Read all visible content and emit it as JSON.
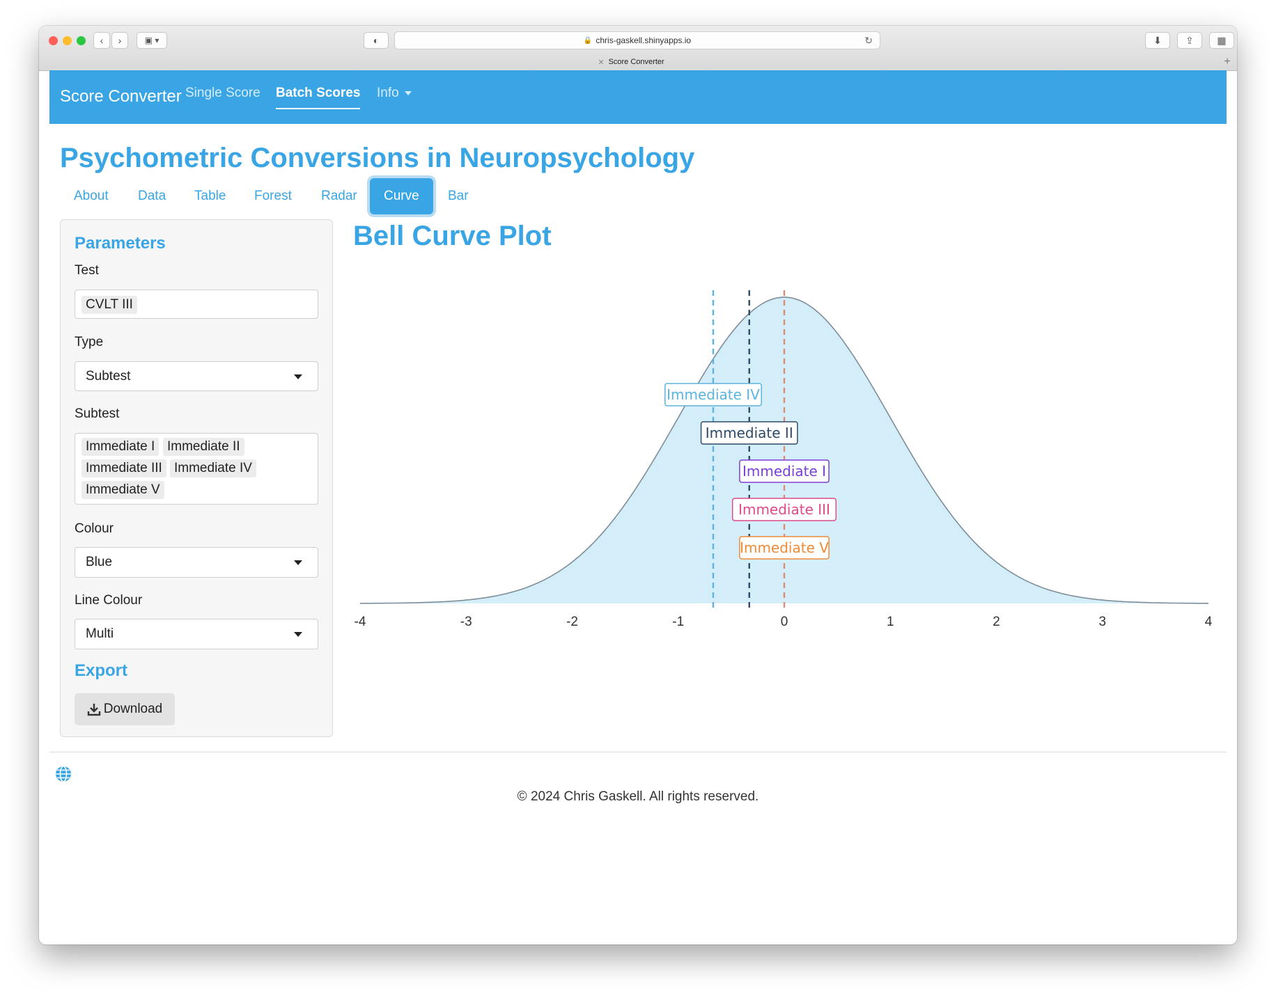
{
  "browser": {
    "url": "chris-gaskell.shinyapps.io",
    "tab_title": "Score Converter"
  },
  "navbar": {
    "brand": "Score Converter",
    "items": [
      {
        "label": "Single Score"
      },
      {
        "label": "Batch Scores",
        "active": true
      },
      {
        "label": "Info"
      }
    ]
  },
  "page": {
    "title": "Psychometric Conversions in Neuropsychology",
    "tabs": [
      {
        "label": "About"
      },
      {
        "label": "Data"
      },
      {
        "label": "Table"
      },
      {
        "label": "Forest"
      },
      {
        "label": "Radar"
      },
      {
        "label": "Curve",
        "active": true
      },
      {
        "label": "Bar"
      }
    ]
  },
  "sidebar": {
    "parameters_heading": "Parameters",
    "test_label": "Test",
    "test_value": "CVLT III",
    "type_label": "Type",
    "type_value": "Subtest",
    "subtest_label": "Subtest",
    "subtests": [
      "Immediate I",
      "Immediate II",
      "Immediate III",
      "Immediate IV",
      "Immediate V"
    ],
    "colour_label": "Colour",
    "colour_value": "Blue",
    "line_colour_label": "Line Colour",
    "line_colour_value": "Multi",
    "export_heading": "Export",
    "download_label": "Download"
  },
  "plot": {
    "title": "Bell Curve Plot"
  },
  "chart_data": {
    "type": "area",
    "distribution": "standard normal",
    "xlim": [
      -4,
      4
    ],
    "x_ticks": [
      -4,
      -3,
      -2,
      -1,
      0,
      1,
      2,
      3,
      4
    ],
    "fill_color": "#d4eef9",
    "line_color": "#7d8d99",
    "grid": false,
    "markers": [
      {
        "label": "Immediate IV",
        "x": -0.67,
        "color": "#5bb4e0"
      },
      {
        "label": "Immediate II",
        "x": -0.33,
        "color": "#2d4a6b"
      },
      {
        "label": "Immediate I",
        "x": 0.0,
        "color": "#7b3fd6"
      },
      {
        "label": "Immediate III",
        "x": 0.0,
        "color": "#e04a8c"
      },
      {
        "label": "Immediate V",
        "x": 0.0,
        "color": "#f08a35"
      }
    ]
  },
  "footer": {
    "copyright": "© 2024 Chris Gaskell. All rights reserved."
  },
  "colors": {
    "accent": "#3aa5e4"
  }
}
